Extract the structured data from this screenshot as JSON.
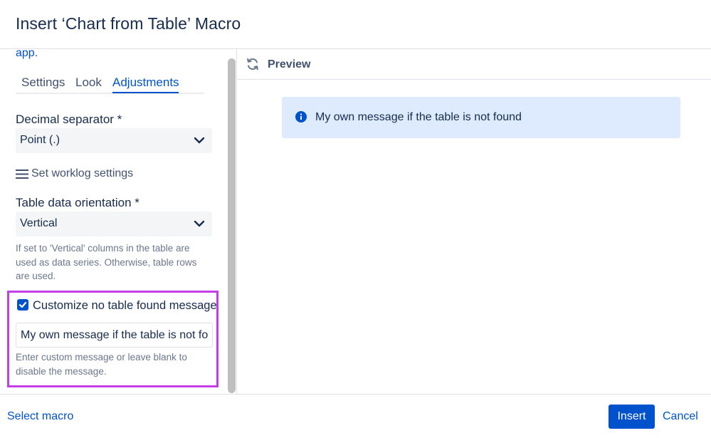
{
  "dialog": {
    "title": "Insert ‘Chart from Table’ Macro"
  },
  "left_panel": {
    "intro_text": "app.",
    "tabs": [
      {
        "label": "Settings",
        "active": false
      },
      {
        "label": "Look",
        "active": false
      },
      {
        "label": "Adjustments",
        "active": true
      }
    ],
    "decimal_separator": {
      "label": "Decimal separator *",
      "value": "Point (.)"
    },
    "worklog": {
      "label": "Set worklog settings",
      "icon": "menu-icon"
    },
    "orientation": {
      "label": "Table data orientation *",
      "value": "Vertical",
      "help": "If set to 'Vertical' columns in the table are used as data series. Otherwise, table rows are used."
    },
    "no_table_message": {
      "checkbox_label": "Customize no table found message",
      "checked": true,
      "input_value": "My own message if the table is not found",
      "help": "Enter custom message or leave blank to disable the message.",
      "highlight_color": "#c13ee8"
    }
  },
  "preview": {
    "label": "Preview",
    "icon": "refresh-icon",
    "info_message": "My own message if the table is not found",
    "info_icon": "info-icon"
  },
  "footer": {
    "select_macro_label": "Select macro",
    "insert_label": "Insert",
    "cancel_label": "Cancel"
  },
  "colors": {
    "primary": "#0052cc",
    "info_background": "#deebff",
    "text": "#172b4d",
    "subtle_text": "#6b778c"
  }
}
